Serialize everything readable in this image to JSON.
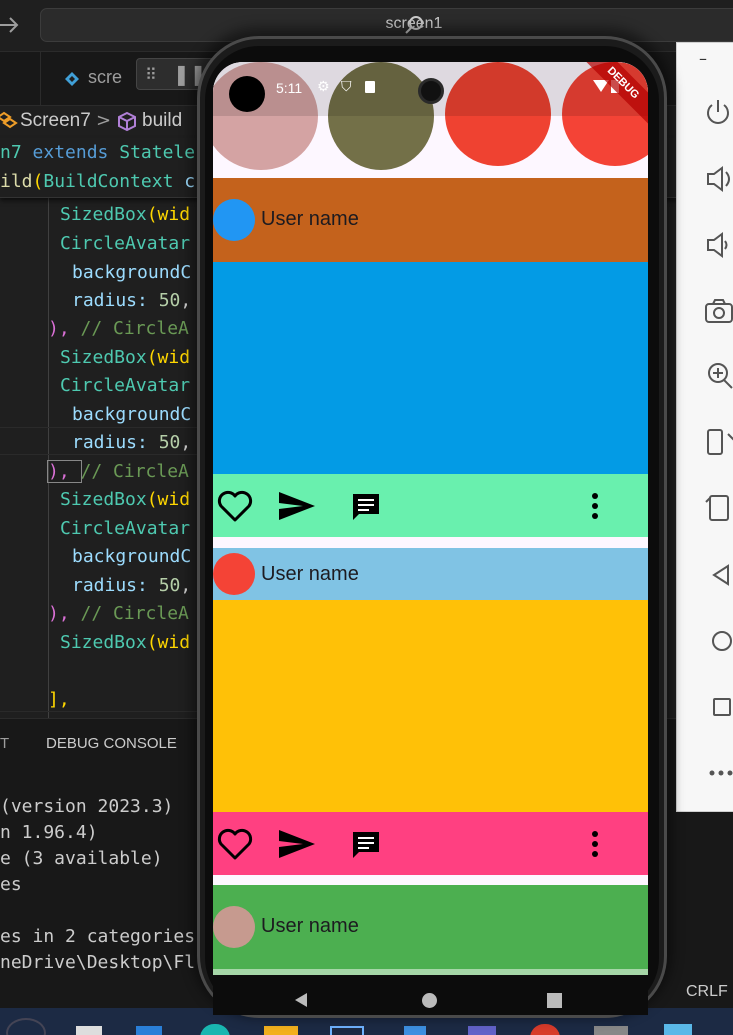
{
  "window": {
    "search_text": "screen1"
  },
  "tabs": {
    "tab1_label": "scre"
  },
  "breadcrumb": {
    "item1": "Screen7",
    "separator": ">",
    "item2": "build"
  },
  "code": {
    "sticky_line1_part1": "n7",
    "sticky_line1_part2": " extends ",
    "sticky_line1_part3": "Statele",
    "sticky_line2_part1": "ild",
    "sticky_line2_part2": "(",
    "sticky_line2_part3": "BuildContext",
    "sticky_line2_part4": " c",
    "line_sized1": "SizedBox",
    "line_sized1_rest": "(wid",
    "line_avatar1": "CircleAvatar",
    "line_bg1": "backgroundC",
    "line_radius1": "radius: ",
    "line_radius1_num": "50",
    "line_close1": "), ",
    "line_close1_comment": "// CircleA",
    "line_sized2": "SizedBox",
    "line_sized2_rest": "(wid",
    "line_avatar2": "CircleAvatar",
    "line_bg2": "backgroundC",
    "line_radius2": "radius: ",
    "line_radius2_num": "50",
    "line_close2": "), ",
    "line_close2_comment": "// CircleA",
    "line_sized3": "SizedBox",
    "line_sized3_rest": "(wid",
    "line_avatar3": "CircleAvatar",
    "line_bg3": "backgroundC",
    "line_radius3": "radius: ",
    "line_radius3_num": "50",
    "line_close3": "), ",
    "line_close3_comment": "// CircleA",
    "line_sized4": "SizedBox",
    "line_sized4_rest": "(wid",
    "line_end": "],"
  },
  "panel": {
    "tab_output": "T",
    "tab_debug": "DEBUG CONSOLE",
    "line1": "(version 2023.3)",
    "line2": "n 1.96.4)",
    "line3": "e (3 available)",
    "line4": "es",
    "line5": "es in 2 categories",
    "line6": "neDrive\\Desktop\\Fl"
  },
  "statusbar": {
    "eol": "CRLF"
  },
  "emulator": {
    "minimize": "–",
    "buttons": [
      "power-icon",
      "volume-up-icon",
      "volume-down-icon",
      "camera-icon",
      "zoom-icon",
      "rotate-left-icon",
      "rotate-right-icon",
      "back-icon",
      "home-icon",
      "overview-icon",
      "more-icon"
    ]
  },
  "phone": {
    "time": "5:11",
    "debug_banner": "DEBUG",
    "top_circles": [
      "#d4a3a3",
      "#737048",
      "#ef4231",
      "#f44336"
    ],
    "posts": [
      {
        "user_name": "User name",
        "header_color": "#c4621c",
        "avatar_color": "#2196f3",
        "body_color": "#039be5",
        "actions_color": "#69f0ae"
      },
      {
        "user_name": "User name",
        "header_color": "#80c3e4",
        "avatar_color": "#f44336",
        "body_color": "#ffc107",
        "actions_color": "#ff4081"
      },
      {
        "user_name": "User name",
        "header_color": "#4caf50",
        "avatar_color": "#c69a8f"
      }
    ]
  }
}
